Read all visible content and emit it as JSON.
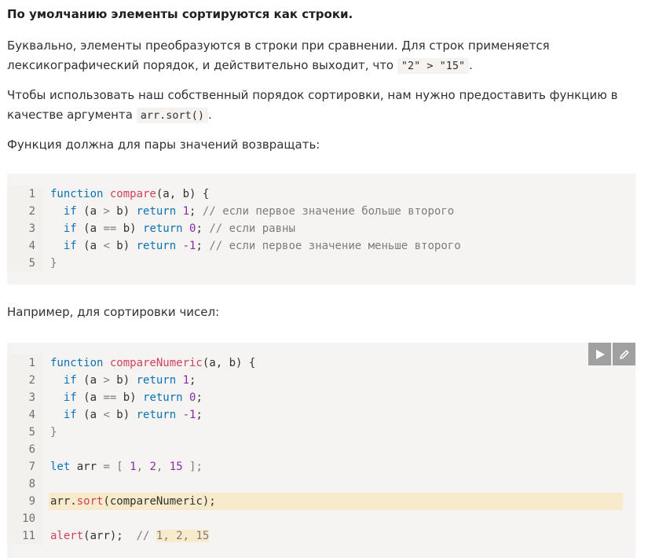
{
  "text": {
    "title": "По умолчанию элементы сортируются как строки.",
    "p1_a": "Буквально, элементы преобразуются в строки при сравнении. Для строк применяется лексикографический порядок, и действительно выходит, что ",
    "p1_code": "\"2\" > \"15\"",
    "p1_b": ".",
    "p2_a": "Чтобы использовать наш собственный порядок сортировки, нам нужно предоставить функцию в качестве аргумента ",
    "p2_code": "arr.sort()",
    "p2_b": ".",
    "p3": "Функция должна для пары значений возвращать:",
    "p4": "Например, для сортировки чисел:"
  },
  "code1": {
    "line_numbers": [
      "1",
      "2",
      "3",
      "4",
      "5"
    ],
    "l1_kw": "function ",
    "l1_fn": "compare",
    "l1_rest": "(a, b) {",
    "l2_if": "  if",
    " l2_a": "",
    "l2_p1": " (a ",
    "l2_op": ">",
    "l2_p2": " b) ",
    "l2_ret": "return ",
    "l2_num": "1",
    "l2_semi": "; ",
    "l2_cm": "// если первое значение больше второго",
    "l3_if": "  if",
    "l3_p1": " (a ",
    "l3_op": "==",
    "l3_p2": " b) ",
    "l3_ret": "return ",
    "l3_num": "0",
    "l3_semi": "; ",
    "l3_cm": "// если равны",
    "l4_if": "  if",
    "l4_p1": " (a ",
    "l4_op": "<",
    "l4_p2": " b) ",
    "l4_ret": "return ",
    "l4_num": "-1",
    "l4_semi": "; ",
    "l4_cm": "// если первое значение меньше второго",
    "l5": "}"
  },
  "code2": {
    "line_numbers": [
      "1",
      "2",
      "3",
      "4",
      "5",
      "6",
      "7",
      "8",
      "9",
      "10",
      "11"
    ],
    "l1_kw": "function ",
    "l1_fn": "compareNumeric",
    "l1_rest": "(a, b) {",
    "l2_if": "  if",
    "l2_p1": " (a ",
    "l2_op": ">",
    "l2_p2": " b) ",
    "l2_ret": "return ",
    "l2_num": "1",
    "l2_semi": ";",
    "l3_if": "  if",
    "l3_p1": " (a ",
    "l3_op": "==",
    "l3_p2": " b) ",
    "l3_ret": "return ",
    "l3_num": "0",
    "l3_semi": ";",
    "l4_if": "  if",
    "l4_p1": " (a ",
    "l4_op": "<",
    "l4_p2": " b) ",
    "l4_ret": "return ",
    "l4_num": "-1",
    "l4_semi": ";",
    "l5": "}",
    "l7_kw": "let ",
    "l7_var": "arr ",
    "l7_op": "=",
    "l7_b1": " [ ",
    "l7_n1": "1",
    "l7_c1": ", ",
    "l7_n2": "2",
    "l7_c2": ", ",
    "l7_n3": "15",
    "l7_b2": " ];",
    "l9_a": "arr.",
    "l9_fn": "sort",
    "l9_rest": "(compareNumeric);",
    "l11_fn": "alert",
    "l11_rest": "(arr);  ",
    "l11_cm": "// ",
    "l11_mark": "1, 2, 15"
  },
  "toolbar": {
    "run_icon": "play-icon",
    "edit_icon": "pencil-icon"
  },
  "colors": {
    "keyword": "#0b72b3",
    "function": "#d13f59",
    "number": "#8a2ba0",
    "highlight": "#f7ebcb"
  }
}
